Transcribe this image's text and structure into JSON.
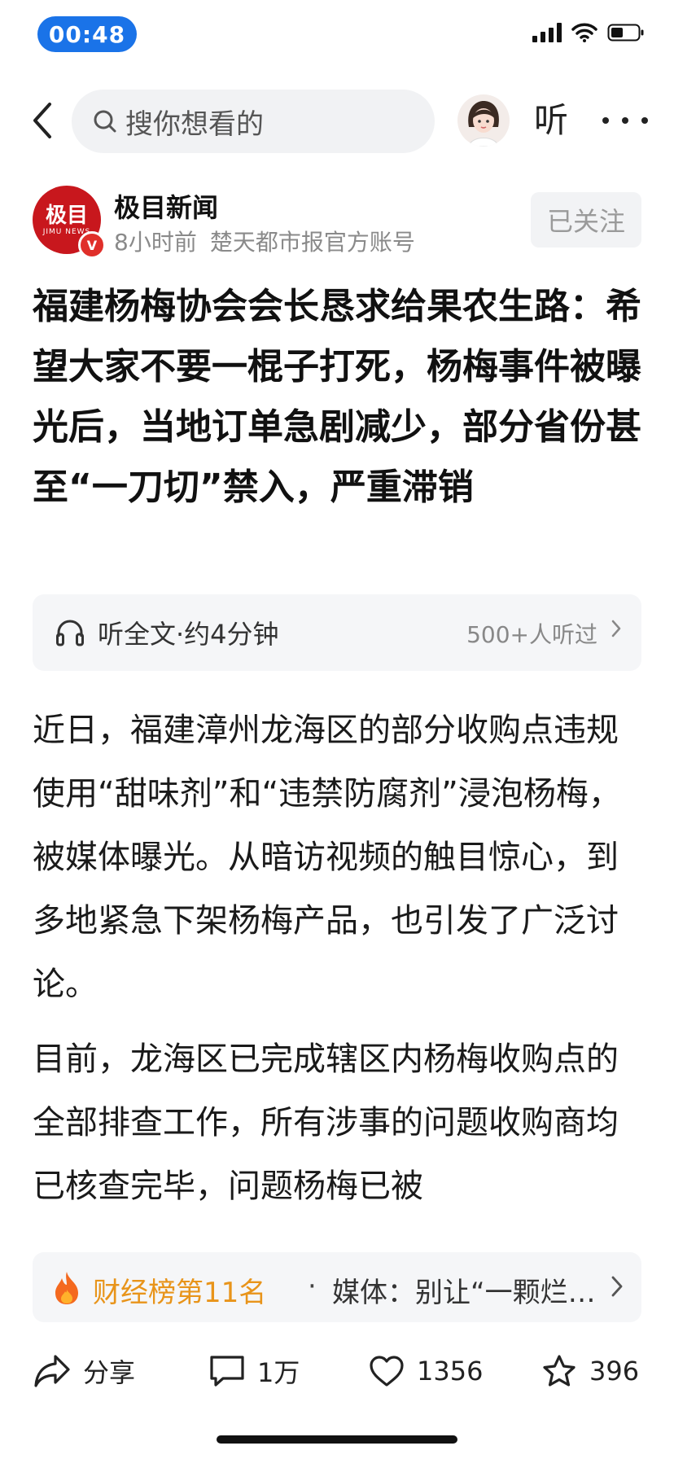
{
  "status": {
    "time": "00:48"
  },
  "nav": {
    "search_placeholder": "搜你想看的",
    "listen_label": "听"
  },
  "author": {
    "logo_text": "极目",
    "logo_subtext": "JIMU NEWS",
    "verified_badge": "V",
    "name": "极目新闻",
    "time_ago": "8小时前",
    "account_desc": "楚天都市报官方账号",
    "follow_label": "已关注"
  },
  "article": {
    "title": "福建杨梅协会会长恳求给果农生路：希望大家不要一棍子打死，杨梅事件被曝光后，当地订单急剧减少，部分省份甚至“一刀切”禁入，严重滞销",
    "listen_label": "听全文·约4分钟",
    "listen_count": "500+人听过",
    "paragraph_1": "近日，福建漳州龙海区的部分收购点违规使用“甜味剂”和“违禁防腐剂”浸泡杨梅，被媒体曝光。从暗访视频的触目惊心，到多地紧急下架杨梅产品，也引发了广泛讨论。",
    "paragraph_2": "目前，龙海区已完成辖区内杨梅收购点的全部排查工作，所有涉事的问题收购商均已核查完毕，问题杨梅已被"
  },
  "hot": {
    "rank_label": "财经榜第11名",
    "separator": "·",
    "headline": "媒体：别让“一颗烂…"
  },
  "actions": {
    "share_label": "分享",
    "comment_count": "1万",
    "like_count": "1356",
    "favorite_count": "396"
  },
  "colors": {
    "accent_blue": "#1a73e8",
    "brand_red": "#c8171d",
    "hot_orange": "#e8941a"
  }
}
